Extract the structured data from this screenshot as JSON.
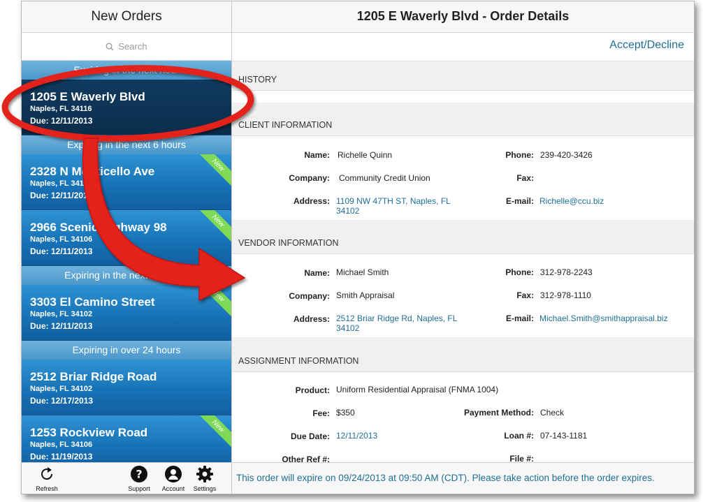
{
  "left": {
    "title": "New Orders",
    "search_placeholder": "Search",
    "groups": [
      {
        "label": "Expiring in the next hour",
        "orders": [
          {
            "address": "1205 E Waverly Blvd",
            "city": "Naples, FL 34116",
            "due": "Due: 12/11/2013",
            "selected": true,
            "badge": ""
          }
        ]
      },
      {
        "label": "Expiring in the next 6 hours",
        "orders": [
          {
            "address": "2328 N Monticello Ave",
            "city": "Naples, FL 34102",
            "due": "Due: 12/11/2013",
            "badge": "New"
          },
          {
            "address": "2966 Scenic Highway 98",
            "city": "Naples, FL 34106",
            "due": "Due: 12/11/2013",
            "badge": "New"
          }
        ]
      },
      {
        "label": "Expiring in the next 12 hours",
        "orders": [
          {
            "address": "3303 El Camino Street",
            "city": "Naples, FL 34102",
            "due": "Due: 12/11/2013",
            "badge": "New"
          }
        ]
      },
      {
        "label": "Expiring in over 24 hours",
        "orders": [
          {
            "address": "2512 Briar Ridge Road",
            "city": "Naples, FL 34102",
            "due": "Due: 12/17/2013",
            "badge": ""
          },
          {
            "address": "1253 Rockview Road",
            "city": "Naples, FL 34106",
            "due": "Due: 11/19/2013",
            "badge": "New"
          }
        ]
      }
    ],
    "toolbar": {
      "refresh": "Refresh",
      "support": "Support",
      "account": "Account",
      "settings": "Settings"
    }
  },
  "right": {
    "title": "1205 E Waverly Blvd - Order Details",
    "accept_decline": "Accept/Decline",
    "sections": {
      "history": "HISTORY",
      "client": "CLIENT INFORMATION",
      "vendor": "VENDOR INFORMATION",
      "assignment": "ASSIGNMENT INFORMATION"
    },
    "client": {
      "name_label": "Name:",
      "name": "Richelle Quinn",
      "company_label": "Company:",
      "company": "Community Credit Union",
      "address_label": "Address:",
      "address_line1": "1109 NW 47TH ST,  Naples, FL",
      "address_line2": "34102",
      "phone_label": "Phone:",
      "phone": "239-420-3426",
      "fax_label": "Fax:",
      "fax": "",
      "email_label": "E-mail:",
      "email": "Richelle@ccu.biz"
    },
    "vendor": {
      "name_label": "Name:",
      "name": "Michael Smith",
      "company_label": "Company:",
      "company": "Smith Appraisal",
      "address_label": "Address:",
      "address_line1": "2512 Briar Ridge Rd,  Naples, FL",
      "address_line2": "34102",
      "phone_label": "Phone:",
      "phone": "312-978-2243",
      "fax_label": "Fax:",
      "fax": "312-978-1110",
      "email_label": "E-mail:",
      "email": "Michael.Smith@smithappraisal.biz"
    },
    "assignment": {
      "product_label": "Product:",
      "product": "Uniform Residential Appraisal (FNMA 1004)",
      "fee_label": "Fee:",
      "fee": "$350",
      "payment_label": "Payment Method:",
      "payment": "Check",
      "due_label": "Due Date:",
      "due": "12/11/2013",
      "loan_label": "Loan #:",
      "loan": "07-143-1181",
      "otherref_label": "Other Ref #:",
      "otherref": "",
      "file_label": "File #:",
      "file": ""
    },
    "footer": "This order will expire on 09/24/2013 at 09:50 AM (CDT).  Please take action before the order expires."
  },
  "colors": {
    "link": "#1d6f93",
    "list_blue": "#1e6fae",
    "selected": "#0b2d4b",
    "badge": "#7ed957",
    "annotation_red": "#e3201b"
  },
  "icons": {
    "search": "search-icon",
    "refresh": "refresh-icon",
    "support": "question-icon",
    "account": "person-icon",
    "settings": "gear-icon"
  }
}
